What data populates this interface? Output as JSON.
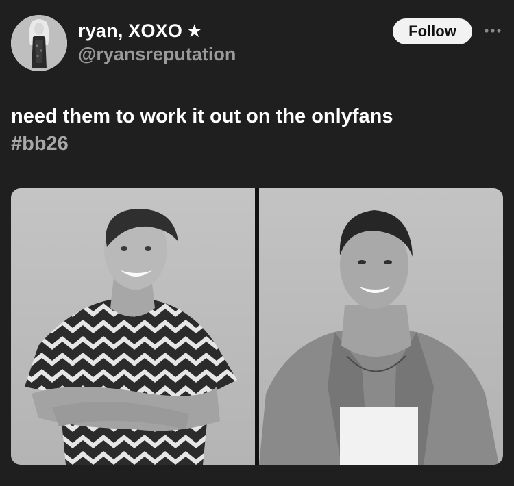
{
  "tweet": {
    "author": {
      "display_name": "ryan, XOXO",
      "badge_icon": "star-icon",
      "badge_glyph": "★",
      "handle": "@ryansreputation"
    },
    "follow_label": "Follow",
    "more_icon": "more-options-icon",
    "text": "need them to work it out on the onlyfans",
    "hashtag": "#bb26",
    "colors": {
      "background": "#1f1f1f",
      "text": "#ffffff",
      "muted": "#9a9a9a",
      "follow_bg": "#f2f2f2"
    }
  }
}
